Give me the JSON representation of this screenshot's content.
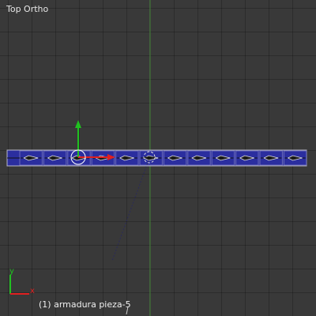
{
  "viewport": {
    "view_name": "Top Ortho",
    "object_info": "(1) armadura pieza-5"
  },
  "widget": {
    "axis_x_label": "x",
    "axis_y_label": "y"
  },
  "colors": {
    "background": "#393939",
    "grid_line": "#2f2f2f",
    "axis_green": "#4b8a40",
    "armature_fill": "#2b2e9f",
    "armature_outline": "#b8b8c8",
    "bone_wire": "#101010",
    "gizmo_red": "#e02020",
    "gizmo_green": "#20c020"
  }
}
